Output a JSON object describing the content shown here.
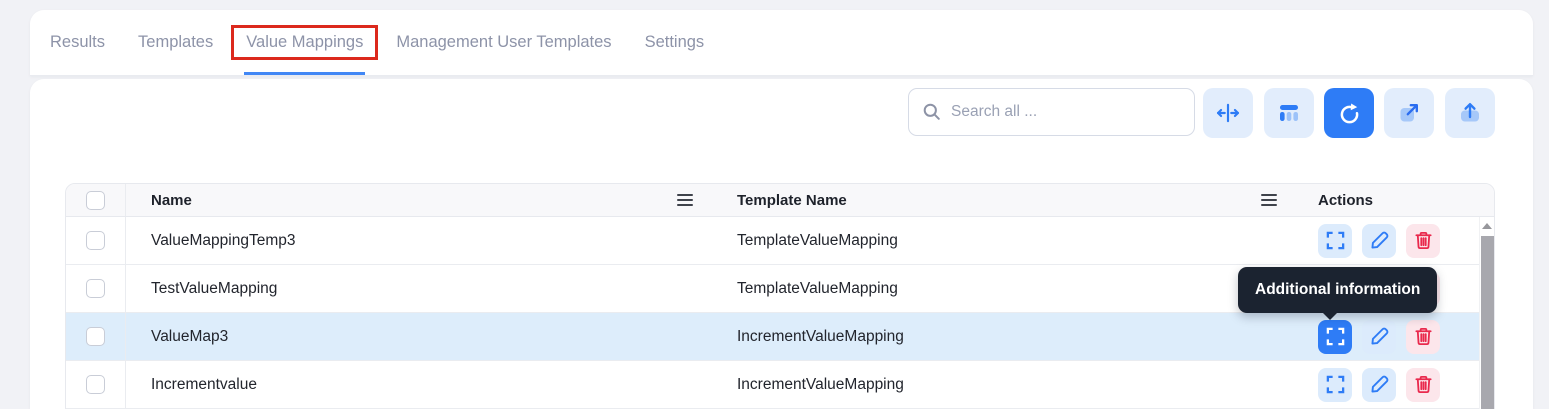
{
  "tabs": [
    {
      "label": "Results"
    },
    {
      "label": "Templates"
    },
    {
      "label": "Value Mappings"
    },
    {
      "label": "Management User Templates"
    },
    {
      "label": "Settings"
    }
  ],
  "toolbar": {
    "search_placeholder": "Search all ...",
    "buttons": [
      {
        "name": "fit-columns"
      },
      {
        "name": "choose-columns"
      },
      {
        "name": "refresh"
      },
      {
        "name": "open-in-new"
      },
      {
        "name": "export"
      }
    ]
  },
  "table": {
    "headers": {
      "name": "Name",
      "template": "Template Name",
      "actions": "Actions"
    },
    "rows": [
      {
        "name": "ValueMappingTemp3",
        "template": "TemplateValueMapping"
      },
      {
        "name": "TestValueMapping",
        "template": "TemplateValueMapping"
      },
      {
        "name": "ValueMap3",
        "template": "IncrementValueMapping",
        "selected": true
      },
      {
        "name": "Incrementvalue",
        "template": "IncrementValueMapping"
      }
    ]
  },
  "tooltip": {
    "text": "Additional information"
  },
  "colors": {
    "accent": "#2e7cf6",
    "accent_light": "#dcebfc",
    "danger": "#e9294d",
    "danger_light": "#fce6eb",
    "selected_row": "#ddedfb",
    "annotation_red": "#dc291d",
    "tooltip_bg": "#1b2330",
    "tab_underline": "#4187f5"
  }
}
